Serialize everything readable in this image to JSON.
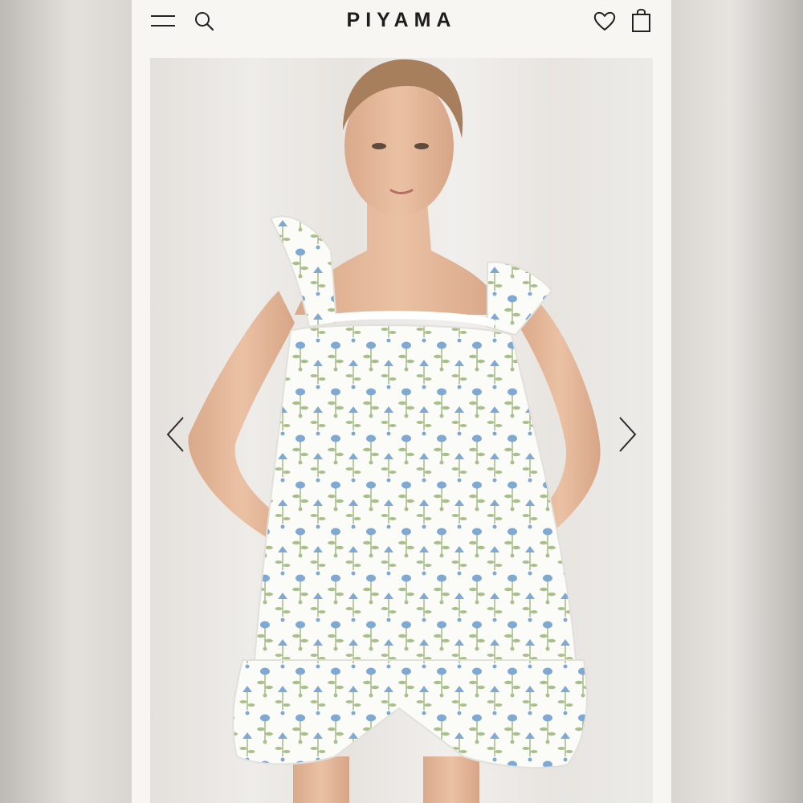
{
  "header": {
    "brand": "PIYAMA",
    "icons": [
      "hamburger-menu-icon",
      "search-icon",
      "heart-icon",
      "shopping-bag-icon"
    ]
  },
  "gallery": {
    "image_subject": "model-wearing-floral-ruffle-pajama-set",
    "controls": [
      "chevron-left-icon",
      "chevron-right-icon"
    ]
  },
  "colors": {
    "page_background": "#f7f6f3",
    "text": "#1d1d1d",
    "print_blue": "#7fa9d3",
    "print_green": "#a9bf8c"
  }
}
